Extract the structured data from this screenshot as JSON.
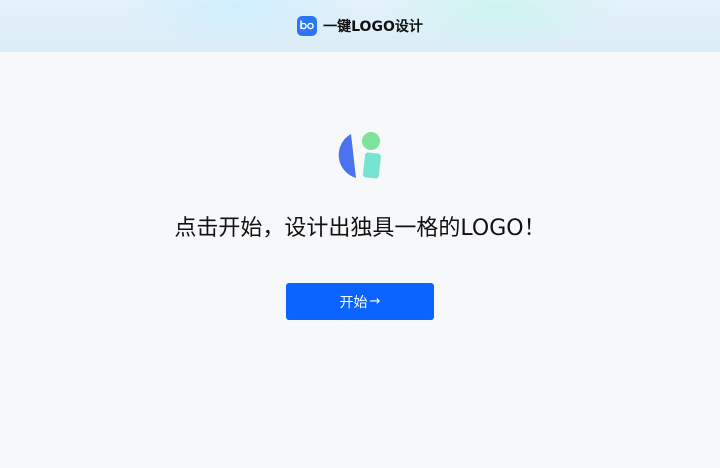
{
  "header": {
    "title": "一键LOGO设计",
    "icon": "logo-glyph-icon",
    "icon_color": "#2b76f6"
  },
  "hero": {
    "icon": "colorful-shapes-logo-icon",
    "headline": "点击开始，设计出独具一格的LOGO！"
  },
  "start_button": {
    "label": "开始",
    "arrow": "→",
    "color": "#0b64ff"
  },
  "colors": {
    "page_background": "#f7f8fa",
    "shape_blue": "#4b73f0",
    "shape_green": "#7de39a",
    "shape_teal": "#78e3d1"
  }
}
